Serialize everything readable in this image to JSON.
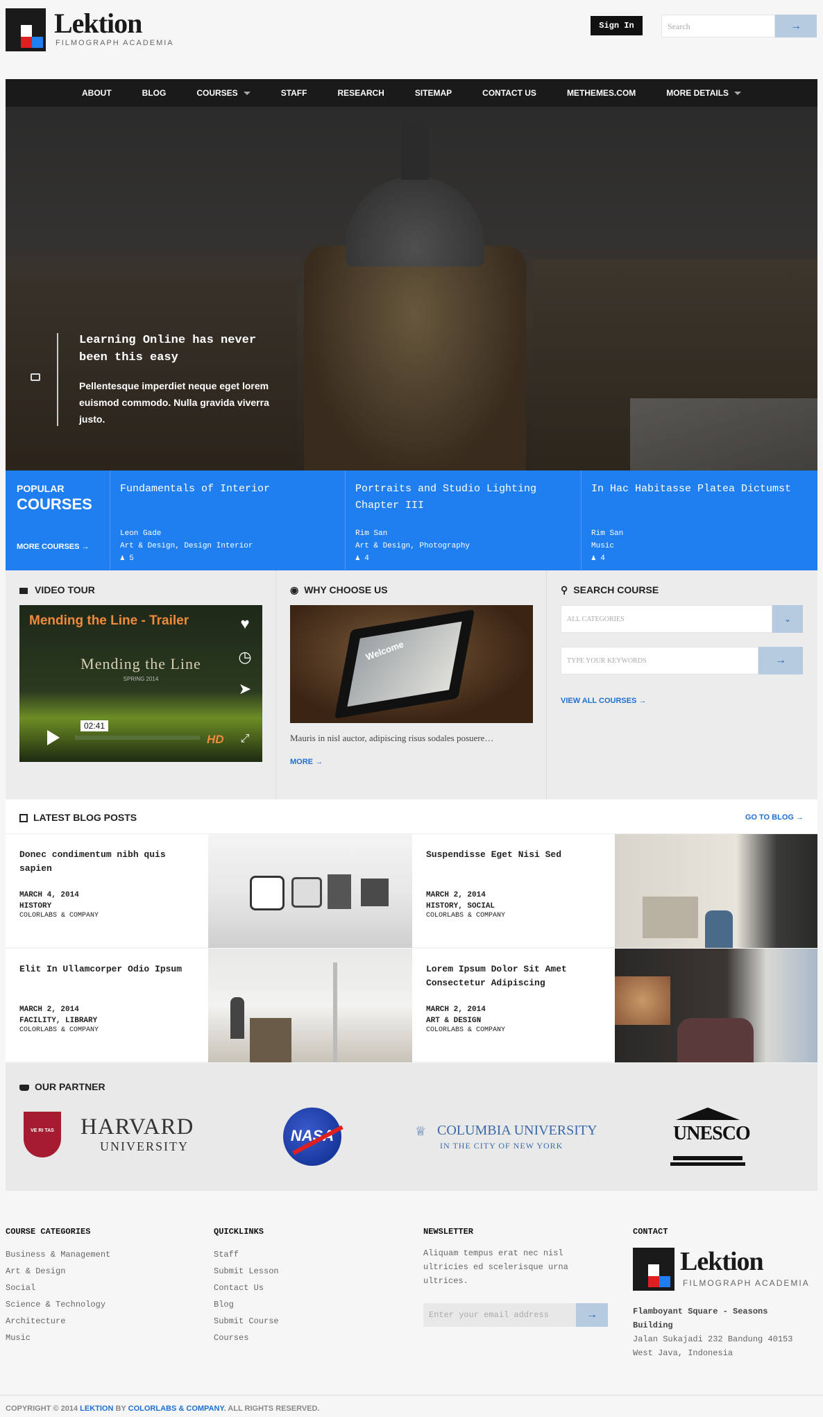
{
  "brand": {
    "name": "Lektion",
    "tagline": "FILMOGRAPH ACADEMIA"
  },
  "header": {
    "signin_label": "Sign In",
    "search_placeholder": "Search",
    "search_button": "→"
  },
  "nav": {
    "items": [
      "ABOUT",
      "BLOG",
      "COURSES",
      "STAFF",
      "RESEARCH",
      "SITEMAP",
      "CONTACT US",
      "METHEMES.COM",
      "MORE DETAILS"
    ],
    "dropdowns": [
      2,
      8
    ]
  },
  "hero": {
    "title": "Learning Online has never been this easy",
    "text": "Pellentesque imperdiet neque eget lorem euismod commodo. Nulla gravida viverra justo."
  },
  "popular": {
    "line1": "POPULAR",
    "line2": "COURSES",
    "more": "MORE COURSES →"
  },
  "courses": [
    {
      "title": "Fundamentals of Interior",
      "author": "Leon Gade",
      "category": "Art & Design, Design Interior",
      "students": "5"
    },
    {
      "title": "Portraits and Studio Lighting Chapter III",
      "author": "Rim San",
      "category": "Art & Design, Photography",
      "students": "4"
    },
    {
      "title": "In Hac Habitasse Platea Dictumst",
      "author": "Rim San",
      "category": "Music",
      "students": "4"
    }
  ],
  "video_tour": {
    "heading": "VIDEO TOUR",
    "video_title": "Mending the Line - Trailer",
    "overlay_title": "Mending the Line",
    "overlay_sub": "SPRING 2014",
    "time": "02:41",
    "hd": "HD"
  },
  "why_choose": {
    "heading": "WHY CHOOSE US",
    "image_text": "Welcome",
    "text": "Mauris in nisl auctor, adipiscing risus sodales posuere…",
    "more": "MORE →"
  },
  "search_course": {
    "heading": "SEARCH COURSE",
    "category_placeholder": "ALL CATEGORIES",
    "keyword_placeholder": "TYPE YOUR KEYWORDS",
    "view_all": "VIEW ALL COURSES →"
  },
  "blog": {
    "heading": "LATEST BLOG POSTS",
    "goto": "GO TO BLOG →",
    "posts": [
      {
        "title": "Donec condimentum nibh quis sapien",
        "date": "MARCH 4, 2014",
        "category": "HISTORY",
        "author": "COLORLABS & COMPANY"
      },
      {
        "title": "Suspendisse Eget Nisi Sed",
        "date": "MARCH 2, 2014",
        "category": "HISTORY, SOCIAL",
        "author": "COLORLABS & COMPANY"
      },
      {
        "title": "Elit In Ullamcorper Odio Ipsum",
        "date": "MARCH 2, 2014",
        "category": "FACILITY, LIBRARY",
        "author": "COLORLABS & COMPANY"
      },
      {
        "title": "Lorem Ipsum Dolor Sit Amet Consectetur Adipiscing",
        "date": "MARCH 2, 2014",
        "category": "ART & DESIGN",
        "author": "COLORLABS & COMPANY"
      }
    ]
  },
  "partners": {
    "heading": "OUR PARTNER",
    "harvard": {
      "name": "HARVARD",
      "sub": "UNIVERSITY",
      "shield": "VE RI TAS"
    },
    "nasa": "NASA",
    "columbia": {
      "name": "COLUMBIA UNIVERSITY",
      "sub": "IN THE CITY OF NEW YORK"
    },
    "unesco": "UNESCO"
  },
  "footer": {
    "categories": {
      "heading": "COURSE CATEGORIES",
      "items": [
        "Business & Management",
        "Art & Design",
        "Social",
        "Science & Technology",
        "Architecture",
        "Music"
      ]
    },
    "quicklinks": {
      "heading": "QUICKLINKS",
      "items": [
        "Staff",
        "Submit Lesson",
        "Contact Us",
        "Blog",
        "Submit Course",
        "Courses"
      ]
    },
    "newsletter": {
      "heading": "NEWSLETTER",
      "text": "Aliquam tempus erat nec nisl ultricies ed scelerisque urna ultrices.",
      "placeholder": "Enter your email address",
      "button": "→"
    },
    "contact": {
      "heading": "CONTACT",
      "line1": "Flamboyant Square - Seasons Building",
      "line2": "Jalan Sukajadi 232 Bandung 40153",
      "line3": "West Java, Indonesia"
    },
    "copyright_pre": "COPYRIGHT © 2014",
    "copyright_brand": "LEKTION",
    "copyright_by": "BY",
    "copyright_company": "COLORLABS & COMPANY",
    "copyright_post": ". ALL RIGHTS RESERVED."
  }
}
